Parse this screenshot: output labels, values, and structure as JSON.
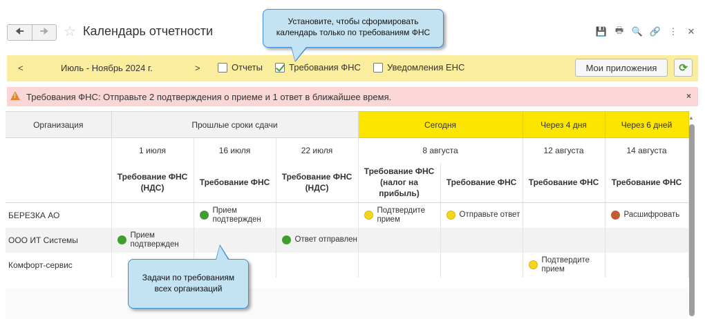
{
  "window": {
    "title": "Календарь отчетности",
    "icons": [
      "save-icon",
      "print-icon",
      "preview-icon",
      "link-icon",
      "more-icon",
      "close-icon"
    ]
  },
  "callouts": {
    "top": "Установите, чтобы сформировать календарь только по требованиям ФНС",
    "bottom": "Задачи по требованиям всех организаций"
  },
  "toolbar": {
    "prev": "<",
    "period": "Июль - Ноябрь 2024 г.",
    "next": ">",
    "checkboxes": [
      {
        "label": "Отчеты",
        "checked": false
      },
      {
        "label": "Требования ФНС",
        "checked": true
      },
      {
        "label": "Уведомления ЕНС",
        "checked": false
      }
    ],
    "apps_label": "Мои приложения",
    "refresh_icon": "refresh-icon"
  },
  "alert": {
    "text": "Требования ФНС: Отправьте 2 подтверждения о приеме и 1 ответ в ближайшее время.",
    "close": "×"
  },
  "table": {
    "org_header": "Организация",
    "groups": [
      "Прошлые сроки сдачи",
      "Сегодня",
      "Через 4 дня",
      "Через 6 дней"
    ],
    "dates": [
      "1 июля",
      "16 июля",
      "22 июля",
      "8 августа",
      "12 августа",
      "14 августа"
    ],
    "columns": [
      "Требование ФНС (НДС)",
      "Требование ФНС",
      "Требование ФНС (НДС)",
      "Требование ФНС (налог на прибыль)",
      "Требование ФНС",
      "Требование ФНС",
      "Требование ФНС"
    ],
    "rows": [
      {
        "org": "БЕРЕЗКА АО",
        "tasks": [
          "",
          "Прием подтвержден",
          "",
          "Подтвердите прием",
          "Отправьте ответ",
          "",
          "Расшифровать"
        ]
      },
      {
        "org": "ООО ИТ Системы",
        "tasks": [
          "Прием подтвержден",
          "",
          "Ответ отправлен",
          "",
          "",
          "",
          ""
        ]
      },
      {
        "org": "Комфорт-сервис",
        "tasks": [
          "",
          "",
          "",
          "",
          "",
          "Подтвердите прием",
          ""
        ]
      }
    ]
  },
  "status_colors": {
    "done": "#3f9e2f",
    "pending": "#f3d620",
    "decode": "#c45b35",
    "today": "#fce600"
  }
}
